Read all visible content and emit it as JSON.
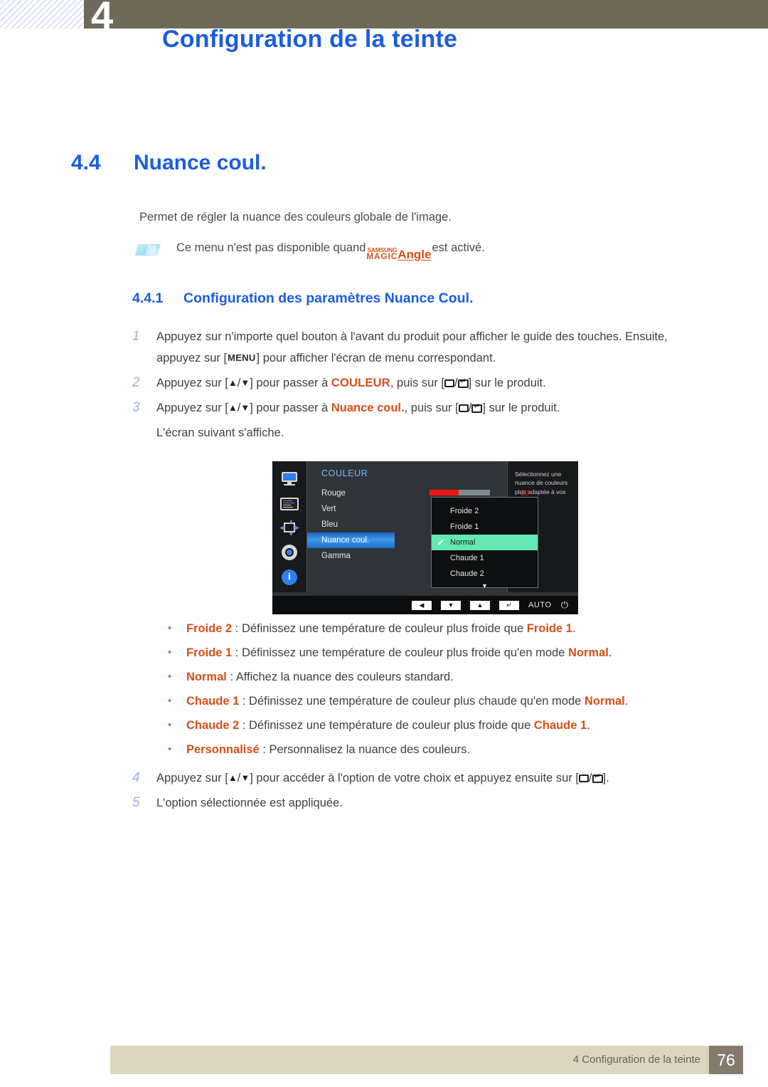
{
  "header": {
    "chapter_number": "4",
    "title": "Configuration de la teinte"
  },
  "section": {
    "number": "4.4",
    "title": "Nuance coul.",
    "intro": "Permet de régler la nuance des couleurs globale de l'image."
  },
  "note": {
    "prefix": "Ce menu n'est pas disponible quand ",
    "logo_top": "SAMSUNG",
    "logo_bottom": "MAGIC",
    "logo_word": "Angle",
    "suffix": " est activé."
  },
  "subsection": {
    "number": "4.4.1",
    "title": "Configuration des paramètres Nuance Coul."
  },
  "steps": {
    "s1_num": "1",
    "s1_a": "Appuyez sur n'importe quel bouton à l'avant du produit pour afficher le guide des touches. Ensuite,",
    "s1_b_pre": "appuyez sur [",
    "s1_key": "MENU",
    "s1_b_post": "] pour afficher l'écran de menu correspondant.",
    "s2_num": "2",
    "s2_a": "Appuyez sur [",
    "s2_b": "] pour passer à ",
    "s2_target": "COULEUR",
    "s2_c": ", puis sur [",
    "s2_d": "] sur le produit.",
    "s3_num": "3",
    "s3_a": "Appuyez sur [",
    "s3_b": "] pour passer à ",
    "s3_target": "Nuance coul.",
    "s3_c": ", puis sur [",
    "s3_d": "] sur le produit.",
    "s3_tail": "L'écran suivant s'affiche.",
    "s4_num": "4",
    "s4_a": "Appuyez sur [",
    "s4_b": "] pour accéder à l'option de votre choix et appuyez ensuite sur [",
    "s4_c": "].",
    "s5_num": "5",
    "s5_text": "L'option sélectionnée est appliquée.",
    "arrow_up": "▲",
    "arrow_sep": "/",
    "arrow_down": "▼"
  },
  "osd": {
    "menu_title": "COULEUR",
    "sidebar_icons": [
      "monitor-icon",
      "color-bars-icon",
      "move-icon",
      "gear-icon",
      "info-icon"
    ],
    "items": [
      {
        "label": "Rouge",
        "selected": false,
        "slider": true,
        "value": "50"
      },
      {
        "label": "Vert",
        "selected": false,
        "slider": false,
        "value": ""
      },
      {
        "label": "Bleu",
        "selected": false,
        "slider": false,
        "value": ""
      },
      {
        "label": "Nuance coul.",
        "selected": true,
        "slider": false,
        "value": ""
      },
      {
        "label": "Gamma",
        "selected": false,
        "slider": false,
        "value": ""
      }
    ],
    "dropdown": [
      {
        "label": "Froide 2",
        "checked": false
      },
      {
        "label": "Froide 1",
        "checked": false
      },
      {
        "label": "Normal",
        "checked": true
      },
      {
        "label": "Chaude 1",
        "checked": false
      },
      {
        "label": "Chaude 2",
        "checked": false
      }
    ],
    "dropdown_more": "▼",
    "help_text": "Sélectionnez une nuance de couleurs plus adaptée à vos besoins.",
    "footer_keys": [
      "◀",
      "▼",
      "▲",
      "↵"
    ],
    "footer_auto": "AUTO",
    "footer_power": "⏻",
    "slider_value_color": "#f01414",
    "highlight_color": "#63e8b2",
    "selected_row_color": "#2f80e0"
  },
  "bullets": [
    {
      "dot": "•",
      "term": "Froide 2",
      "mid": " : Définissez une température de couleur plus froide que ",
      "term2": "Froide 1",
      "end": "."
    },
    {
      "dot": "•",
      "term": "Froide 1",
      "mid": " : Définissez une température de couleur plus froide qu'en mode ",
      "term2": "Normal",
      "end": "."
    },
    {
      "dot": "•",
      "term": "Normal",
      "mid": " : Affichez la nuance des couleurs standard.",
      "term2": "",
      "end": ""
    },
    {
      "dot": "•",
      "term": "Chaude 1",
      "mid": " : Définissez une température de couleur plus chaude qu'en mode ",
      "term2": "Normal",
      "end": "."
    },
    {
      "dot": "•",
      "term": "Chaude 2",
      "mid": " : Définissez une température de couleur plus froide que ",
      "term2": "Chaude 1",
      "end": "."
    },
    {
      "dot": "•",
      "term": "Personnalisé",
      "mid": " : Personnalisez la nuance des couleurs.",
      "term2": "",
      "end": ""
    }
  ],
  "footer": {
    "text": "4 Configuration de la teinte",
    "page": "76"
  },
  "colors": {
    "heading_blue": "#1b5de0",
    "accent_orange": "#d94e18",
    "header_olive": "#6d6a57",
    "footer_beige": "#dcd5c0",
    "footer_page_brown": "#857a6d"
  }
}
